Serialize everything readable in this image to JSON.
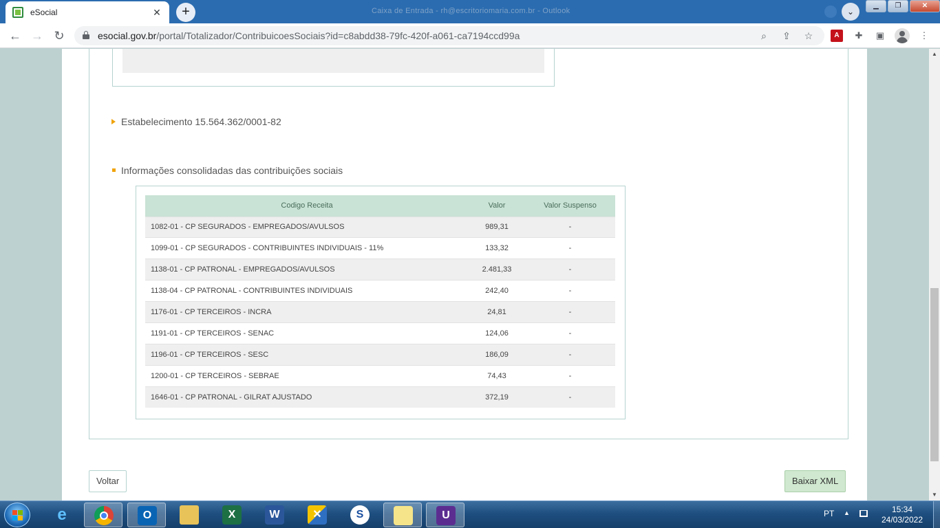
{
  "browser": {
    "tab_title": "eSocial",
    "tab_close": "✕",
    "new_tab": "+",
    "window_title_blurred": "Caixa de Entrada - rh@escritoriomaria.com.br - Outlook",
    "url_host": "esocial.gov.br",
    "url_path": "/portal/Totalizador/ContribuicoesSociais?id=c8abdd38-79fc-420f-a061-ca7194ccd99a",
    "nav": {
      "back": "←",
      "forward": "→",
      "reload": "↻"
    },
    "icons": [
      "zoom-icon",
      "share-icon",
      "bookmark-star-icon",
      "pdf-extension-icon",
      "extensions-puzzle-icon",
      "side-panel-icon",
      "profile-icon",
      "menu-icon"
    ]
  },
  "page": {
    "estabelecimento_title": "Estabelecimento 15.564.362/0001-82",
    "consolidated_title": "Informações consolidadas das contribuições sociais",
    "table": {
      "headers": [
        "Codigo Receita",
        "Valor",
        "Valor Suspenso"
      ],
      "rows": [
        {
          "code": "1082-01 - CP SEGURADOS - EMPREGADOS/AVULSOS",
          "valor": "989,31",
          "suspenso": "-"
        },
        {
          "code": "1099-01 - CP SEGURADOS - CONTRIBUINTES INDIVIDUAIS - 11%",
          "valor": "133,32",
          "suspenso": "-"
        },
        {
          "code": "1138-01 - CP PATRONAL - EMPREGADOS/AVULSOS",
          "valor": "2.481,33",
          "suspenso": "-"
        },
        {
          "code": "1138-04 - CP PATRONAL - CONTRIBUINTES INDIVIDUAIS",
          "valor": "242,40",
          "suspenso": "-"
        },
        {
          "code": "1176-01 - CP TERCEIROS - INCRA",
          "valor": "24,81",
          "suspenso": "-"
        },
        {
          "code": "1191-01 - CP TERCEIROS - SENAC",
          "valor": "124,06",
          "suspenso": "-"
        },
        {
          "code": "1196-01 - CP TERCEIROS - SESC",
          "valor": "186,09",
          "suspenso": "-"
        },
        {
          "code": "1200-01 - CP TERCEIROS - SEBRAE",
          "valor": "74,43",
          "suspenso": "-"
        },
        {
          "code": "1646-01 - CP PATRONAL - GILRAT AJUSTADO",
          "valor": "372,19",
          "suspenso": "-"
        }
      ]
    },
    "buttons": {
      "voltar": "Voltar",
      "baixar_xml": "Baixar XML"
    }
  },
  "taskbar": {
    "apps": [
      "chrome-icon",
      "outlook-icon",
      "file-explorer-icon",
      "excel-icon",
      "word-icon",
      "receita-federal-icon",
      "sefaz-icon",
      "sticky-notes-icon",
      "onenote-icon"
    ],
    "language": "PT",
    "time": "15:34",
    "date": "24/03/2022"
  },
  "colors": {
    "chrome_titlebar": "#2b6cb0",
    "page_background": "#bdd1d1",
    "table_header": "#c9e3d6",
    "accent_marker": "#f0a30a",
    "xml_button": "#cfe8cf"
  }
}
